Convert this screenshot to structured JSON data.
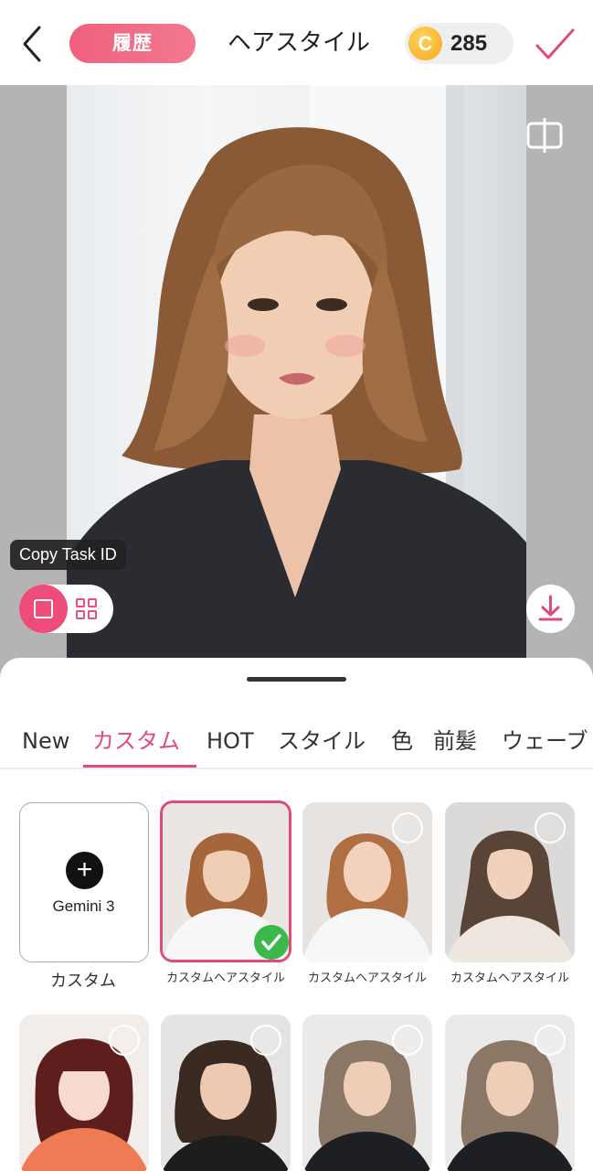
{
  "header": {
    "history_label": "履歴",
    "title": "ヘアスタイル",
    "coin_symbol": "C",
    "coins": "285"
  },
  "stage": {
    "copy_task_label": "Copy Task ID"
  },
  "tabs": [
    {
      "label": "New",
      "active": false
    },
    {
      "label": "カスタム",
      "active": true
    },
    {
      "label": "HOT",
      "active": false
    },
    {
      "label": "スタイル",
      "active": false
    },
    {
      "label": "色",
      "active": false
    },
    {
      "label": "前髪",
      "active": false
    },
    {
      "label": "ウェーブ",
      "active": false
    }
  ],
  "grid": {
    "custom_tile": {
      "button_label": "Gemini 3",
      "caption": "カスタム"
    },
    "items": [
      {
        "caption": "カスタムヘアスタイル",
        "selected": true
      },
      {
        "caption": "カスタムヘアスタイル",
        "selected": false
      },
      {
        "caption": "カスタムヘアスタイル",
        "selected": false
      },
      {
        "caption": "",
        "selected": false
      },
      {
        "caption": "",
        "selected": false
      },
      {
        "caption": "",
        "selected": false
      },
      {
        "caption": "",
        "selected": false
      }
    ]
  },
  "colors": {
    "accent": "#e04b7a",
    "history_gradient_start": "#f0607e",
    "coin": "#f5a91c",
    "check": "#3cb84a"
  }
}
